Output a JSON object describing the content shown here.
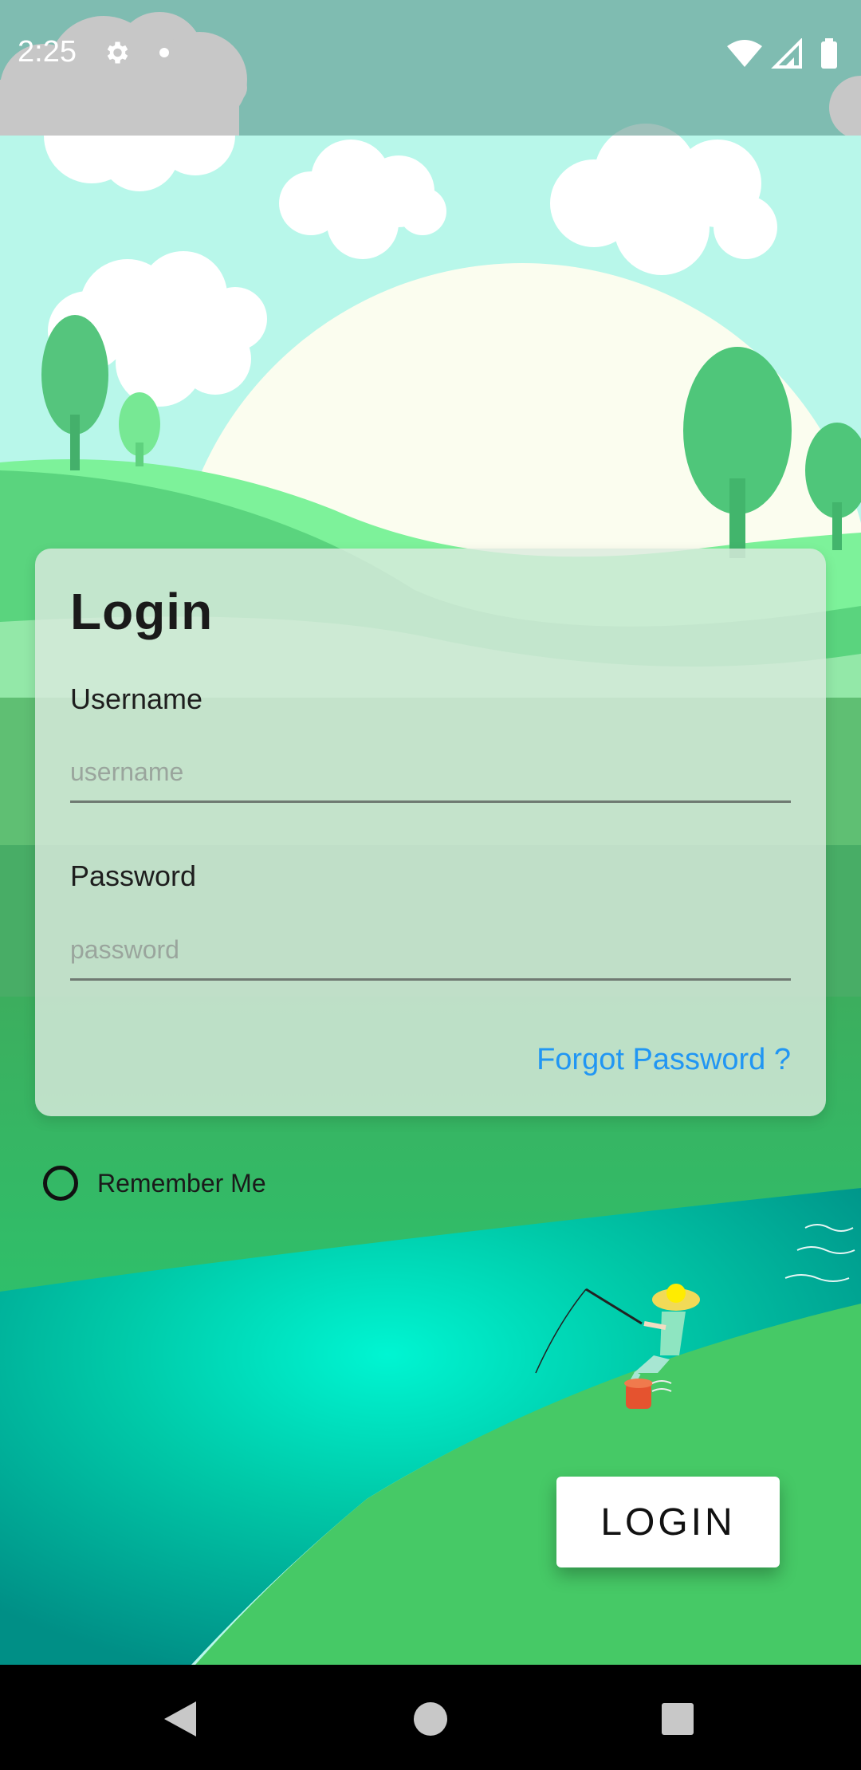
{
  "status_bar": {
    "time": "2:25",
    "icons": [
      "gear-icon",
      "notification-dot-icon",
      "wifi-icon",
      "signal-icon",
      "battery-icon"
    ]
  },
  "login_card": {
    "title": "Login",
    "username_label": "Username",
    "username_placeholder": "username",
    "username_value": "",
    "password_label": "Password",
    "password_placeholder": "password",
    "password_value": "",
    "forgot_password": "Forgot Password ?"
  },
  "remember_me": {
    "label": "Remember Me",
    "checked": false
  },
  "login_button": {
    "label": "LOGIN"
  },
  "nav_bar": {
    "icons": [
      "back-icon",
      "home-icon",
      "recents-icon"
    ]
  },
  "colors": {
    "sky": "#b8f7ea",
    "hills": "#46c66a",
    "river": "#00d9b7",
    "card": "#dae9de",
    "link": "#2196f3"
  }
}
